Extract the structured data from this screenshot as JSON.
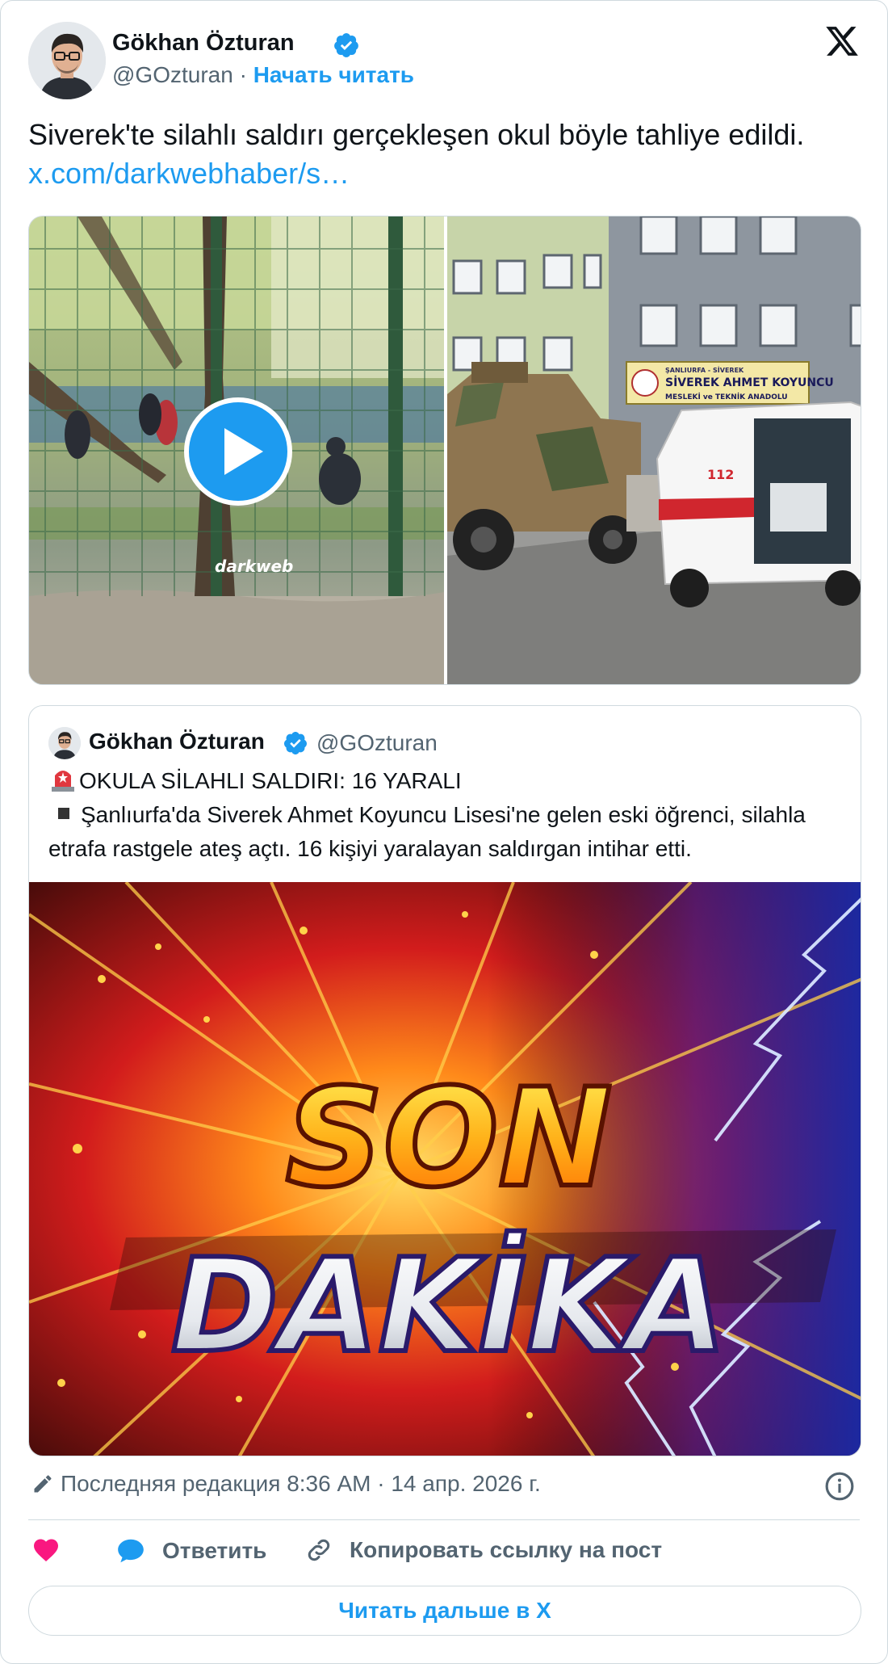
{
  "author": {
    "name": "Gökhan Özturan",
    "handle": "@GOzturan",
    "separator": " · ",
    "follow_label": "Начать читать"
  },
  "tweet": {
    "text": "Siverek'te silahlı saldırı gerçekleşen okul böyle tahliye edildi. ",
    "link": "x.com/darkwebhaber/s…"
  },
  "media": {
    "watermark": "darkweb",
    "sign_line1": "ŞANLIURFA - SİVEREK",
    "sign_line2": "SİVEREK AHMET KOYUNCU",
    "sign_line3": "MESLEKİ ve TEKNİK ANADOLU",
    "ambulance_number": "112"
  },
  "quote": {
    "name": "Gökhan Özturan",
    "handle": "@GOzturan",
    "line1": "OKULA SİLAHLI SALDIRI: 16 YARALI",
    "line2": "Şanlıurfa'da Siverek Ahmet Koyuncu Lisesi'ne gelen eski öğrenci, silahla etrafa rastgele ateş açtı. 16 kişiyi yaralayan saldırgan intihar etti.",
    "image_word1": "SON",
    "image_word2": "DAKİKA"
  },
  "footer": {
    "edited_text": "Последняя редакция 8:36 AM · 14 апр. 2026 г.",
    "reply_label": "Ответить",
    "copy_label": "Копировать ссылку на пост",
    "read_more_label": "Читать дальше в X"
  },
  "colors": {
    "accent": "#1d9bf0",
    "like": "#f91880",
    "secondary_text": "#536471",
    "border": "#cfd9de"
  }
}
